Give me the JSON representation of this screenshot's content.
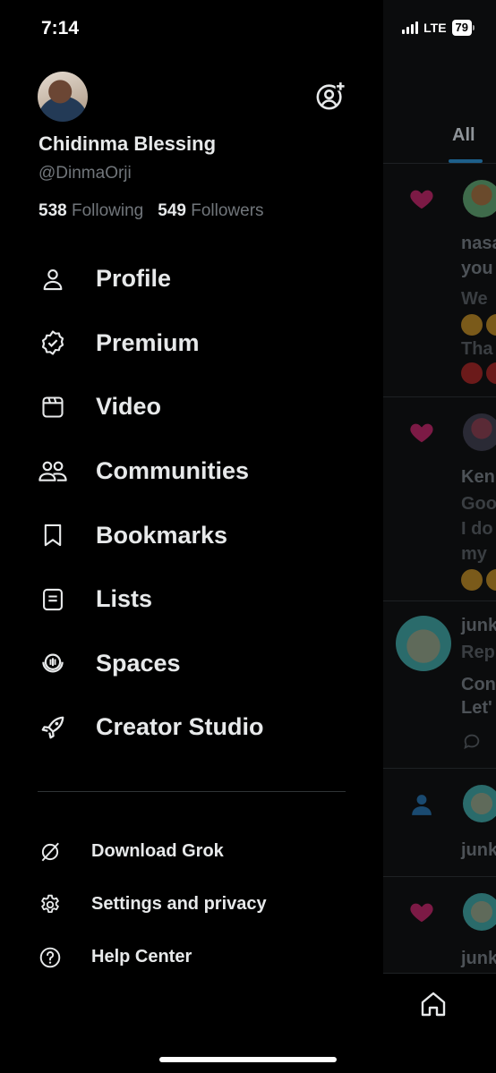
{
  "status_bar": {
    "time": "7:14",
    "network": "LTE",
    "battery": "79"
  },
  "profile": {
    "display_name": "Chidinma Blessing",
    "handle": "@DinmaOrji",
    "following_count": "538",
    "following_label": "Following",
    "followers_count": "549",
    "followers_label": "Followers"
  },
  "menu": [
    {
      "label": "Profile",
      "icon": "person-icon"
    },
    {
      "label": "Premium",
      "icon": "verified-badge-icon"
    },
    {
      "label": "Video",
      "icon": "video-icon"
    },
    {
      "label": "Communities",
      "icon": "communities-icon"
    },
    {
      "label": "Bookmarks",
      "icon": "bookmark-icon"
    },
    {
      "label": "Lists",
      "icon": "list-icon"
    },
    {
      "label": "Spaces",
      "icon": "spaces-icon"
    },
    {
      "label": "Creator Studio",
      "icon": "rocket-icon"
    }
  ],
  "secondary_menu": [
    {
      "label": "Download Grok",
      "icon": "grok-icon"
    },
    {
      "label": "Settings and privacy",
      "icon": "gear-icon"
    },
    {
      "label": "Help Center",
      "icon": "help-icon"
    }
  ],
  "background_timeline": {
    "tab_label": "All",
    "snippets": [
      "nasa",
      "you",
      "We",
      "Tha",
      "Ken",
      "Goo",
      "I do",
      "my",
      "junk",
      "Rep",
      "Con",
      "Let'",
      "junk",
      "junk"
    ]
  },
  "colors": {
    "background": "#000000",
    "text": "#e7e9ea",
    "secondary_text": "#71767b",
    "like_heart": "#f91880"
  }
}
